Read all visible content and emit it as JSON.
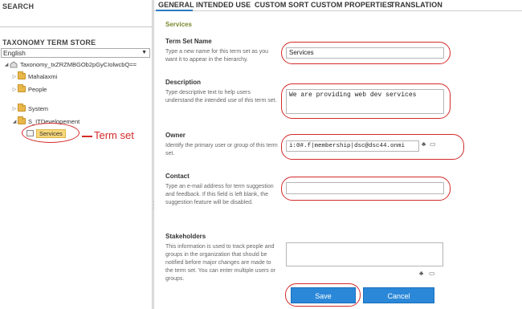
{
  "left": {
    "search_label": "SEARCH",
    "store_label": "TAXONOMY TERM STORE",
    "language": "English",
    "tree": {
      "root": "Taxonomy_txZRZMBGOb2pGyCIolwcbQ==",
      "items": [
        "Mahalaxmi",
        "People",
        "System",
        "S_ITDevelopement",
        "Services"
      ]
    },
    "annotation": "Term set"
  },
  "tabs": [
    "GENERAL",
    "INTENDED USE",
    "CUSTOM SORT",
    "CUSTOM PROPERTIES",
    "TRANSLATION"
  ],
  "panel": {
    "title": "Services",
    "fields": {
      "name": {
        "title": "Term Set Name",
        "desc": "Type a new name for this term set as you want it to appear in the hierarchy.",
        "value": "Services"
      },
      "description": {
        "title": "Description",
        "desc": "Type descriptive text to help users understand the intended use of this term set.",
        "value": "We are providing web dev services"
      },
      "owner": {
        "title": "Owner",
        "desc": "Identify the primary user or group of this term set.",
        "value": "i:0#.f|membership|dsc@dsc44.onmi"
      },
      "contact": {
        "title": "Contact",
        "desc": "Type an e-mail address for term suggestion and feedback. If this field is left blank, the suggestion feature will be disabled.",
        "value": ""
      },
      "stakeholders": {
        "title": "Stakeholders",
        "desc": "This information is used to track people and groups in the organization that should be notified before major changes are made to the term set. You can enter multiple users or groups.",
        "value": ""
      }
    },
    "buttons": {
      "save": "Save",
      "cancel": "Cancel"
    }
  }
}
